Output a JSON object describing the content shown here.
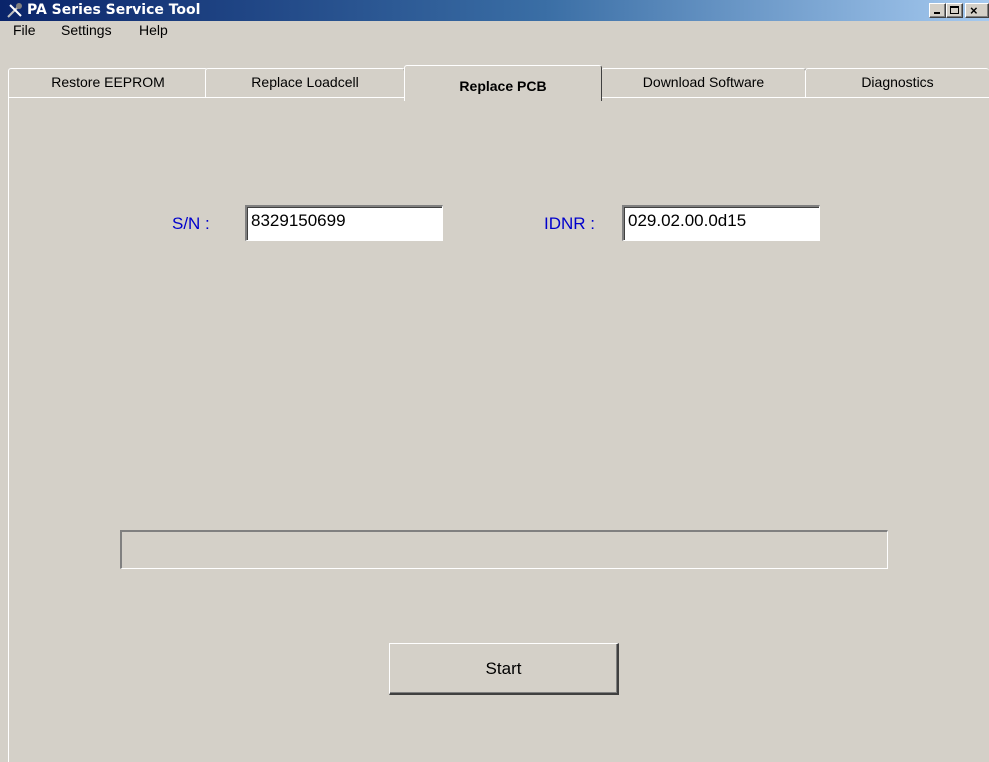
{
  "window": {
    "title": "PA Series Service Tool",
    "app_icon": "tool-icon",
    "controls": {
      "minimize": "minimize-icon",
      "maximize": "maximize-icon",
      "close": "×"
    }
  },
  "menu": {
    "items": [
      "File",
      "Settings",
      "Help"
    ]
  },
  "tabs": {
    "items": [
      "Restore EEPROM",
      "Replace Loadcell",
      "Replace PCB",
      "Download Software",
      "Diagnostics"
    ],
    "active": "Replace PCB"
  },
  "form": {
    "sn_label": "S/N :",
    "sn_value": "8329150699",
    "idnr_label": "IDNR :",
    "idnr_value": "029.02.00.0d15"
  },
  "progress": {
    "value": 0
  },
  "actions": {
    "start_label": "Start"
  },
  "colors": {
    "titlebar_start": "#0a246a",
    "titlebar_end": "#a6caf0",
    "label_blue": "#0000cc",
    "face": "#d4d0c8"
  }
}
